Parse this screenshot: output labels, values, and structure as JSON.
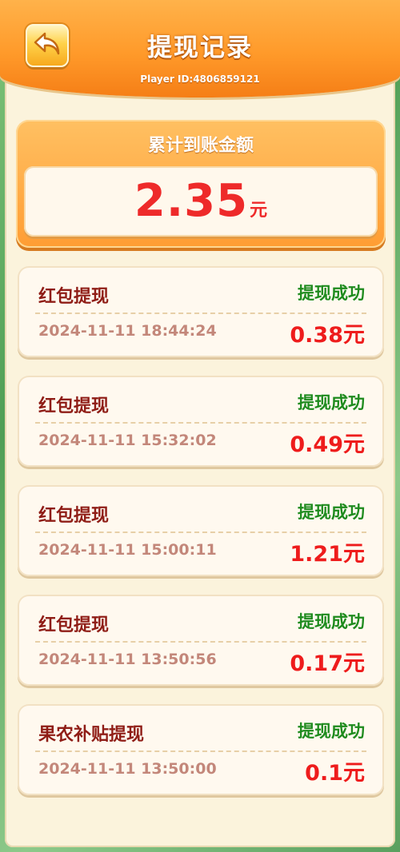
{
  "header": {
    "title": "提现记录",
    "player_id": "Player ID:4806859121",
    "back_icon": "back-arrow-icon"
  },
  "summary": {
    "label": "累计到账金额",
    "amount": "2.35",
    "unit": "元"
  },
  "records": [
    {
      "name": "红包提现",
      "status": "提现成功",
      "time": "2024-11-11 18:44:24",
      "amount": "0.38元"
    },
    {
      "name": "红包提现",
      "status": "提现成功",
      "time": "2024-11-11 15:32:02",
      "amount": "0.49元"
    },
    {
      "name": "红包提现",
      "status": "提现成功",
      "time": "2024-11-11 15:00:11",
      "amount": "1.21元"
    },
    {
      "name": "红包提现",
      "status": "提现成功",
      "time": "2024-11-11 13:50:56",
      "amount": "0.17元"
    },
    {
      "name": "果农补贴提现",
      "status": "提现成功",
      "time": "2024-11-11 13:50:00",
      "amount": "0.1元"
    }
  ],
  "colors": {
    "header": "#ff9a2a",
    "amount_red": "#ee1c1c",
    "success_green": "#1e8b1e",
    "record_name": "#8f1d16"
  }
}
